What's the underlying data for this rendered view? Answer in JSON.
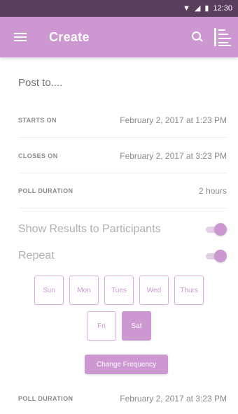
{
  "status_bar": {
    "time": "12:30"
  },
  "app_bar": {
    "title": "Create",
    "menu_icon": "hamburger-icon",
    "search_icon": "search-icon",
    "filter_icon": "filter-icon"
  },
  "post_to": "Post to....",
  "fields": [
    {
      "label": "STARTS ON",
      "value": "February 2, 2017 at 1:23 PM"
    },
    {
      "label": "CLOSES ON",
      "value": "February 2, 2017 at 3:23 PM"
    },
    {
      "label": "POLL DURATION",
      "value": "2 hours"
    }
  ],
  "toggles": [
    {
      "label": "Show Results to Participants",
      "on": true
    },
    {
      "label": "Repeat",
      "on": true
    }
  ],
  "days_row1": [
    "Sun",
    "Mon",
    "Tues",
    "Wed",
    "Thurs"
  ],
  "days_row2": [
    "Fri",
    "Sat"
  ],
  "selected_day": "Sat",
  "change_frequency": "Change Frequency",
  "footer_field": {
    "label": "POLL DURATION",
    "value": "February 2, 2017 at 3:23 PM"
  },
  "colors": {
    "accent": "#cd98d2",
    "status_bar": "#5b3d5e"
  }
}
